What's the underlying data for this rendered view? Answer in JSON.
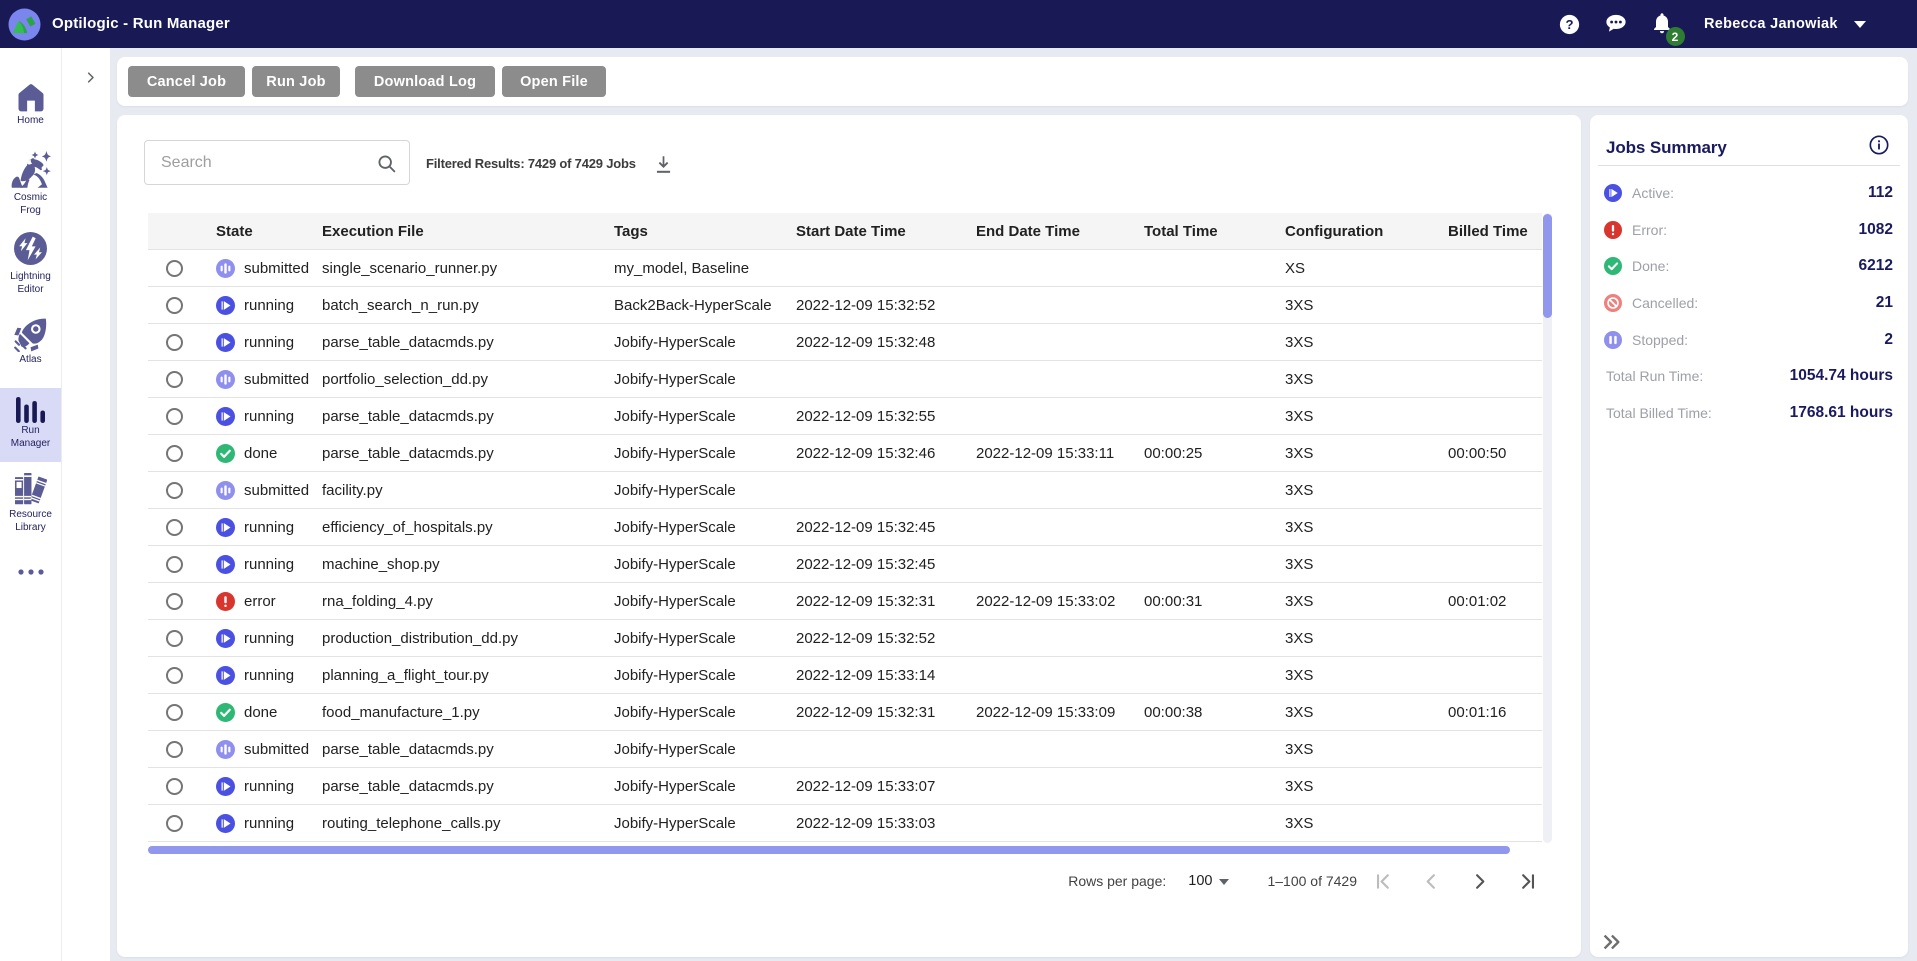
{
  "topbar": {
    "title": "Optilogic - Run Manager",
    "user_name": "Rebecca Janowiak",
    "notification_count": "2"
  },
  "sidebar": {
    "items": [
      {
        "id": "home",
        "icon": "home-icon",
        "lines": [
          "Home"
        ],
        "active": false
      },
      {
        "id": "cosmic-frog",
        "icon": "cosmic-frog-icon",
        "lines": [
          "Cosmic",
          "Frog"
        ],
        "active": false
      },
      {
        "id": "lightning-editor",
        "icon": "lightning-editor-icon",
        "lines": [
          "Lightning",
          "Editor"
        ],
        "active": false
      },
      {
        "id": "atlas",
        "icon": "atlas-icon",
        "lines": [
          "Atlas"
        ],
        "active": false
      },
      {
        "id": "run-manager",
        "icon": "run-manager-icon",
        "lines": [
          "Run",
          "Manager"
        ],
        "active": true
      },
      {
        "id": "resource-library",
        "icon": "resource-library-icon",
        "lines": [
          "Resource",
          "Library"
        ],
        "active": false
      },
      {
        "id": "more",
        "icon": "more-dots-icon",
        "lines": [],
        "active": false
      }
    ]
  },
  "toolbar": {
    "buttons": [
      {
        "id": "cancel-job",
        "label": "Cancel Job"
      },
      {
        "id": "run-job",
        "label": "Run Job"
      },
      {
        "id": "download-log",
        "label": "Download Log"
      },
      {
        "id": "open-file",
        "label": "Open File"
      }
    ]
  },
  "search": {
    "placeholder": "Search"
  },
  "filtered_results": "Filtered Results: 7429 of 7429 Jobs",
  "table": {
    "columns": [
      "State",
      "Execution File",
      "Tags",
      "Start Date Time",
      "End Date Time",
      "Total Time",
      "Configuration",
      "Billed Time"
    ],
    "rows": [
      {
        "state": "submitted",
        "file": "single_scenario_runner.py",
        "tags": "my_model, Baseline",
        "start": "",
        "end": "",
        "total": "",
        "config": "XS",
        "billed": ""
      },
      {
        "state": "running",
        "file": "batch_search_n_run.py",
        "tags": "Back2Back-HyperScale",
        "start": "2022-12-09 15:32:52",
        "end": "",
        "total": "",
        "config": "3XS",
        "billed": ""
      },
      {
        "state": "running",
        "file": "parse_table_datacmds.py",
        "tags": "Jobify-HyperScale",
        "start": "2022-12-09 15:32:48",
        "end": "",
        "total": "",
        "config": "3XS",
        "billed": ""
      },
      {
        "state": "submitted",
        "file": "portfolio_selection_dd.py",
        "tags": "Jobify-HyperScale",
        "start": "",
        "end": "",
        "total": "",
        "config": "3XS",
        "billed": ""
      },
      {
        "state": "running",
        "file": "parse_table_datacmds.py",
        "tags": "Jobify-HyperScale",
        "start": "2022-12-09 15:32:55",
        "end": "",
        "total": "",
        "config": "3XS",
        "billed": ""
      },
      {
        "state": "done",
        "file": "parse_table_datacmds.py",
        "tags": "Jobify-HyperScale",
        "start": "2022-12-09 15:32:46",
        "end": "2022-12-09 15:33:11",
        "total": "00:00:25",
        "config": "3XS",
        "billed": "00:00:50"
      },
      {
        "state": "submitted",
        "file": "facility.py",
        "tags": "Jobify-HyperScale",
        "start": "",
        "end": "",
        "total": "",
        "config": "3XS",
        "billed": ""
      },
      {
        "state": "running",
        "file": "efficiency_of_hospitals.py",
        "tags": "Jobify-HyperScale",
        "start": "2022-12-09 15:32:45",
        "end": "",
        "total": "",
        "config": "3XS",
        "billed": ""
      },
      {
        "state": "running",
        "file": "machine_shop.py",
        "tags": "Jobify-HyperScale",
        "start": "2022-12-09 15:32:45",
        "end": "",
        "total": "",
        "config": "3XS",
        "billed": ""
      },
      {
        "state": "error",
        "file": "rna_folding_4.py",
        "tags": "Jobify-HyperScale",
        "start": "2022-12-09 15:32:31",
        "end": "2022-12-09 15:33:02",
        "total": "00:00:31",
        "config": "3XS",
        "billed": "00:01:02"
      },
      {
        "state": "running",
        "file": "production_distribution_dd.py",
        "tags": "Jobify-HyperScale",
        "start": "2022-12-09 15:32:52",
        "end": "",
        "total": "",
        "config": "3XS",
        "billed": ""
      },
      {
        "state": "running",
        "file": "planning_a_flight_tour.py",
        "tags": "Jobify-HyperScale",
        "start": "2022-12-09 15:33:14",
        "end": "",
        "total": "",
        "config": "3XS",
        "billed": ""
      },
      {
        "state": "done",
        "file": "food_manufacture_1.py",
        "tags": "Jobify-HyperScale",
        "start": "2022-12-09 15:32:31",
        "end": "2022-12-09 15:33:09",
        "total": "00:00:38",
        "config": "3XS",
        "billed": "00:01:16"
      },
      {
        "state": "submitted",
        "file": "parse_table_datacmds.py",
        "tags": "Jobify-HyperScale",
        "start": "",
        "end": "",
        "total": "",
        "config": "3XS",
        "billed": ""
      },
      {
        "state": "running",
        "file": "parse_table_datacmds.py",
        "tags": "Jobify-HyperScale",
        "start": "2022-12-09 15:33:07",
        "end": "",
        "total": "",
        "config": "3XS",
        "billed": ""
      },
      {
        "state": "running",
        "file": "routing_telephone_calls.py",
        "tags": "Jobify-HyperScale",
        "start": "2022-12-09 15:33:03",
        "end": "",
        "total": "",
        "config": "3XS",
        "billed": ""
      }
    ]
  },
  "pagination": {
    "rows_per_page_label": "Rows per page:",
    "rows_per_page_value": "100",
    "range_text": "1–100 of 7429"
  },
  "colors": {
    "topbar_bg": "#191a55",
    "navy_text": "#1a1b5e",
    "active_item_bg": "#d9daf6",
    "sidebar_icon": "#5b5b95",
    "running_active": "#4a50e2",
    "submitted_stopped": "#8f90ee",
    "done": "#2fb875",
    "error": "#d8352e",
    "cancelled": "#ef8080",
    "scrollbar_thumb": "#9097ec",
    "button_gray": "#8c8c8c",
    "badge_green": "#2e7d32"
  },
  "jobs_summary": {
    "title": "Jobs Summary",
    "stats": [
      {
        "id": "active",
        "icon": "play-circle-icon",
        "state": "active",
        "label": "Active:",
        "value": "112"
      },
      {
        "id": "error",
        "icon": "error-circle-icon",
        "state": "error",
        "label": "Error:",
        "value": "1082"
      },
      {
        "id": "done",
        "icon": "check-circle-icon",
        "state": "done",
        "label": "Done:",
        "value": "6212"
      },
      {
        "id": "cancelled",
        "icon": "cancel-circle-icon",
        "state": "cancelled",
        "label": "Cancelled:",
        "value": "21"
      },
      {
        "id": "stopped",
        "icon": "pause-circle-icon",
        "state": "stopped",
        "label": "Stopped:",
        "value": "2"
      }
    ],
    "totals": [
      {
        "id": "total-run-time",
        "label": "Total Run Time:",
        "value": "1054.74 hours"
      },
      {
        "id": "total-billed-time",
        "label": "Total Billed Time:",
        "value": "1768.61 hours"
      }
    ]
  }
}
